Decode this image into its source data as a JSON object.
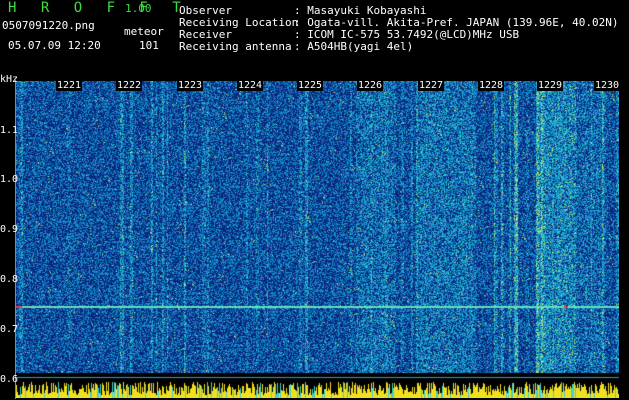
{
  "app": {
    "name": "H R O F F T",
    "version": "1.00"
  },
  "file": {
    "name": "0507091220.png",
    "datetime": "05.07.09 12:20"
  },
  "mode": {
    "label": "meteor",
    "count": "101"
  },
  "info": [
    {
      "key": "Observer",
      "value": ": Masayuki Kobayashi"
    },
    {
      "key": "Receiving Location",
      "value": ": Ogata-vill. Akita-Pref. JAPAN (139.96E, 40.02N)"
    },
    {
      "key": "Receiver",
      "value": ": ICOM IC-575 53.7492(@LCD)MHz USB"
    },
    {
      "key": "Receiving antenna",
      "value": ": A504HB(yagi 4el)"
    }
  ],
  "axis": {
    "unit": "kHz",
    "y_ticks": [
      "1.1",
      "1.0",
      "0.9",
      "0.8",
      "0.7",
      "0.6"
    ],
    "x_ticks": [
      "1221",
      "1222",
      "1223",
      "1224",
      "1225",
      "1226",
      "1227",
      "1228",
      "1229",
      "1230"
    ]
  },
  "colors": {
    "background": "#0a1f6e",
    "trace": "#5fe0c0",
    "baseline": "#f0e020",
    "header_green": "#3fdc3f"
  }
}
